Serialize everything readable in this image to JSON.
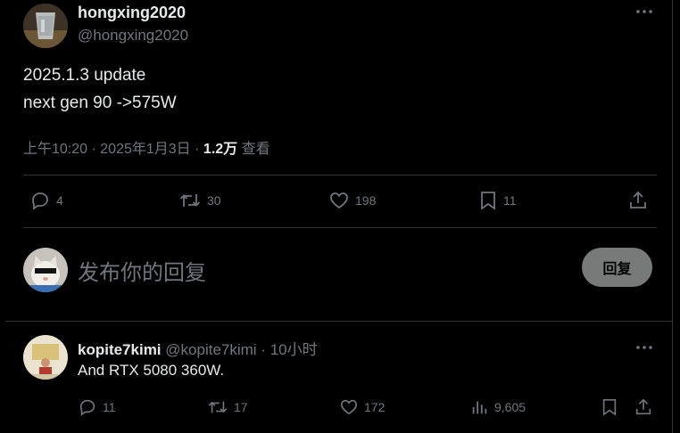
{
  "main_tweet": {
    "author_name": "hongxing2020",
    "author_handle": "@hongxing2020",
    "text_line1": "2025.1.3 update",
    "text_line2": "next gen 90 ->575W",
    "time": "上午10:20",
    "sep1": "·",
    "date": "2025年1月3日",
    "sep2": "·",
    "views_count": "1.2万",
    "views_label": "查看",
    "replies": "4",
    "retweets": "30",
    "likes": "198",
    "bookmarks": "11"
  },
  "reply_box": {
    "placeholder": "发布你的回复",
    "button_label": "回复"
  },
  "reply_tweet": {
    "author_name": "kopite7kimi",
    "author_handle": "@kopite7kimi",
    "sep": "·",
    "time_ago": "10小时",
    "text": "And RTX 5080 360W.",
    "replies": "11",
    "retweets": "17",
    "likes": "172",
    "views": "9,605"
  },
  "colors": {
    "background": "#000000",
    "text_primary": "#e7e9ea",
    "text_secondary": "#71767b",
    "divider": "#2f3336",
    "reply_button": "#787a7a"
  }
}
